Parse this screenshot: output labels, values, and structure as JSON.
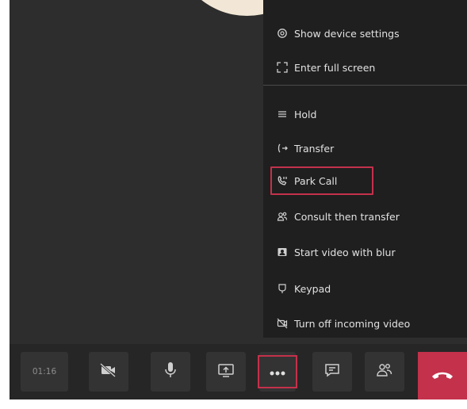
{
  "menu": {
    "items": [
      {
        "label": "Show device settings",
        "icon": "gear-icon"
      },
      {
        "label": "Enter full screen",
        "icon": "fullscreen-icon"
      },
      {
        "label": "Hold",
        "icon": "hold-icon"
      },
      {
        "label": "Transfer",
        "icon": "transfer-icon"
      },
      {
        "label": "Park Call",
        "icon": "park-call-icon"
      },
      {
        "label": "Consult then transfer",
        "icon": "consult-transfer-icon"
      },
      {
        "label": "Start video with blur",
        "icon": "video-blur-icon"
      },
      {
        "label": "Keypad",
        "icon": "keypad-icon"
      },
      {
        "label": "Turn off incoming video",
        "icon": "video-off-icon"
      }
    ],
    "highlighted_item": "Park Call"
  },
  "toolbar": {
    "timer": "01:16",
    "buttons": [
      {
        "name": "camera",
        "icon": "camera-off-icon"
      },
      {
        "name": "microphone",
        "icon": "microphone-icon"
      },
      {
        "name": "share",
        "icon": "share-screen-icon"
      },
      {
        "name": "more-actions",
        "icon": "more-dots-icon"
      },
      {
        "name": "chat",
        "icon": "chat-icon"
      },
      {
        "name": "participants",
        "icon": "people-icon"
      },
      {
        "name": "hang-up",
        "icon": "phone-hangup-icon"
      }
    ]
  },
  "colors": {
    "highlight": "#c4314b",
    "hangup": "#c4314b",
    "background": "#2d2d2d",
    "menu_bg": "#1f1f1f"
  }
}
